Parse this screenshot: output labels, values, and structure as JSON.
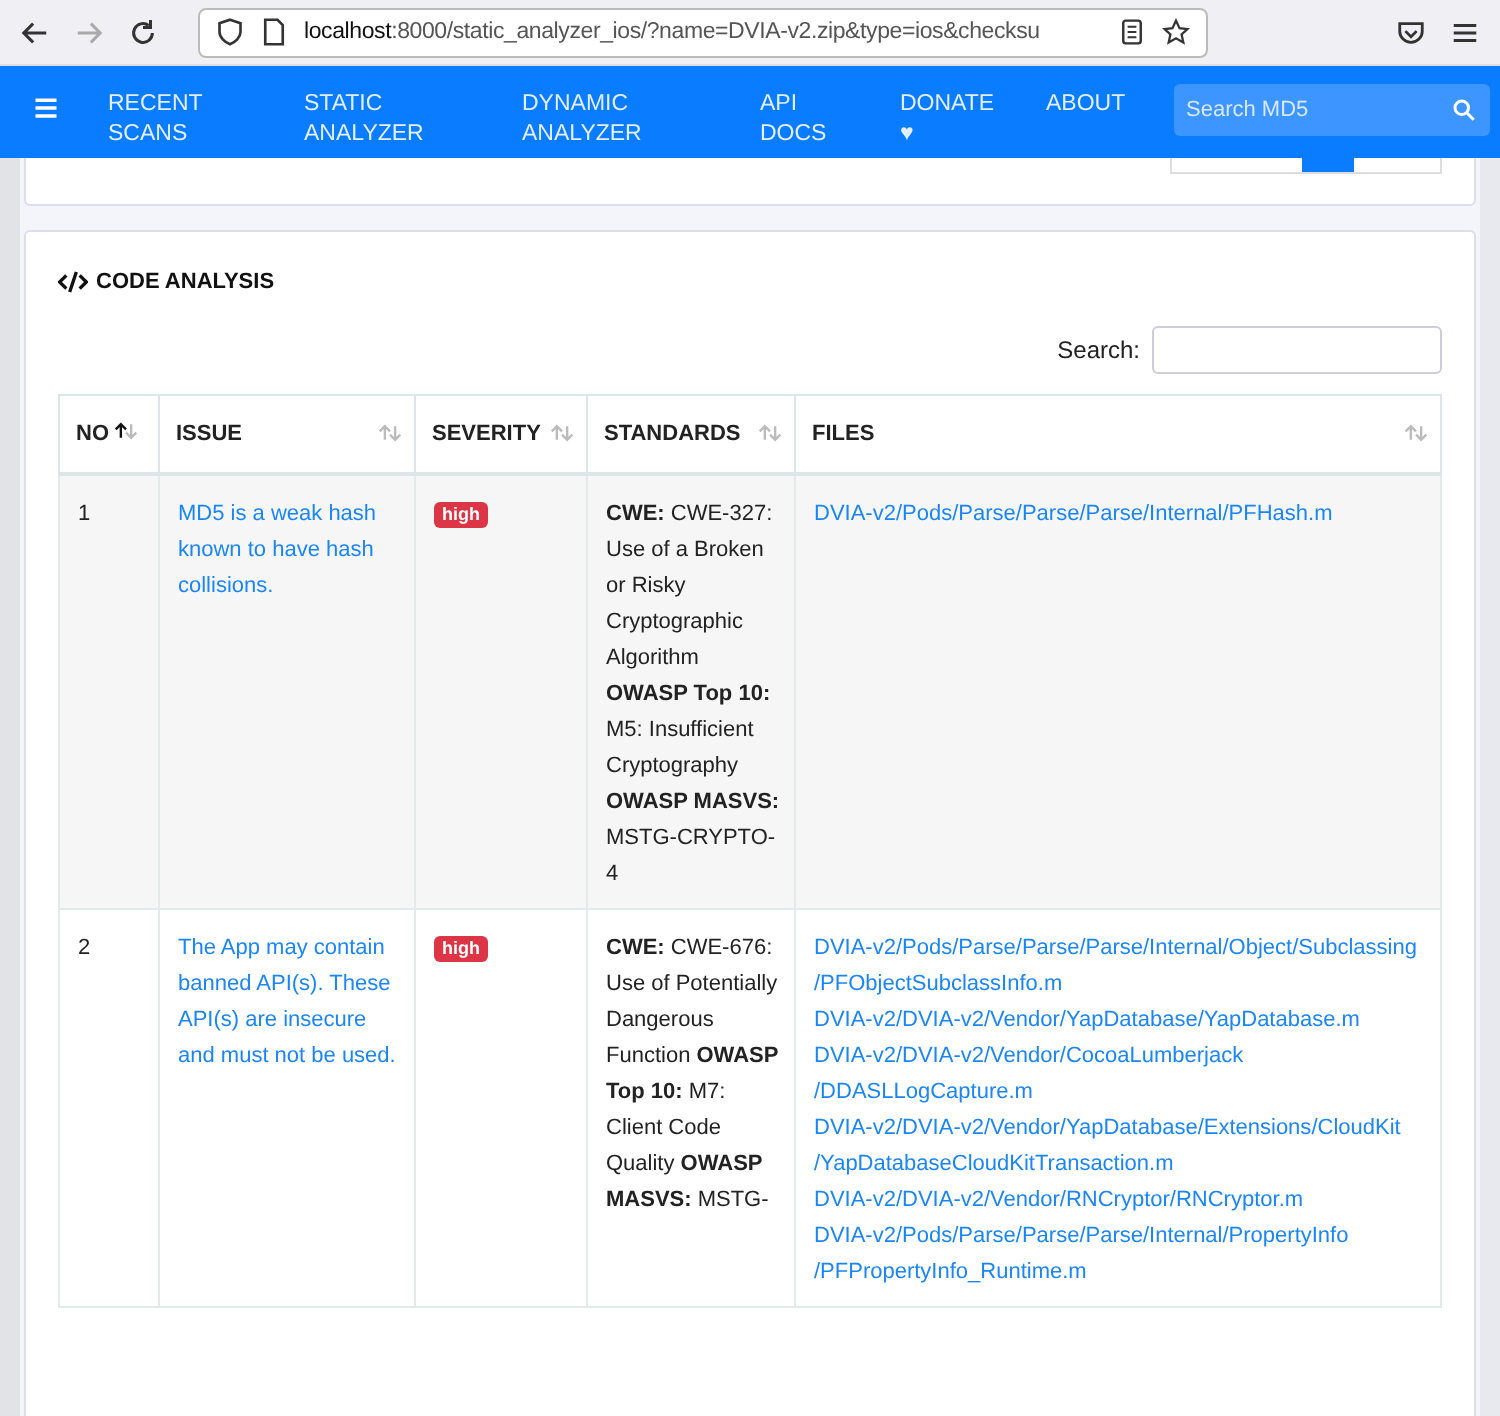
{
  "browser": {
    "url_host": "localhost",
    "url_rest": ":8000/static_analyzer_ios/?name=DVIA-v2.zip&type=ios&checksu"
  },
  "navbar": {
    "items": [
      "RECENT SCANS",
      "STATIC ANALYZER",
      "DYNAMIC ANALYZER",
      "API DOCS",
      "DONATE ♥",
      "ABOUT"
    ],
    "search_placeholder": "Search MD5"
  },
  "section": {
    "title": "CODE ANALYSIS",
    "search_label": "Search:"
  },
  "table": {
    "columns": [
      {
        "label": "NO",
        "sorted": true
      },
      {
        "label": "ISSUE",
        "sorted": false
      },
      {
        "label": "SEVERITY",
        "sorted": false
      },
      {
        "label": "STANDARDS",
        "sorted": false
      },
      {
        "label": "FILES",
        "sorted": false
      }
    ],
    "rows": [
      {
        "no": "1",
        "issue": "MD5 is a weak hash known to have hash collisions.",
        "severity": "high",
        "standards": "**CWE:** CWE-327: Use of a Broken or Risky Cryptographic Algorithm **OWASP Top 10:** M5: Insufficient Cryptography **OWASP MASVS:** MSTG-CRYPTO-4",
        "files": [
          "DVIA-v2/Pods/Parse/Parse/Parse/Internal/PFHash.m"
        ]
      },
      {
        "no": "2",
        "issue": "The App may contain banned API(s). These API(s) are insecure and must not be used.",
        "severity": "high",
        "standards": "**CWE:** CWE-676: Use of Potentially Dangerous Function **OWASP Top 10:** M7: Client Code Quality **OWASP MASVS:** MSTG-",
        "files": [
          "DVIA-v2/Pods/Parse/Parse/Parse/Internal/Object/Subclassing/PFObjectSubclassInfo.m",
          "DVIA-v2/DVIA-v2/Vendor/YapDatabase/YapDatabase.m",
          "DVIA-v2/DVIA-v2/Vendor/CocoaLumberjack/DDASLLogCapture.m",
          "DVIA-v2/DVIA-v2/Vendor/YapDatabase/Extensions/CloudKit/YapDatabaseCloudKitTransaction.m",
          "DVIA-v2/DVIA-v2/Vendor/RNCryptor/RNCryptor.m",
          "DVIA-v2/Pods/Parse/Parse/Parse/Internal/PropertyInfo/PFPropertyInfo_Runtime.m"
        ]
      }
    ]
  }
}
